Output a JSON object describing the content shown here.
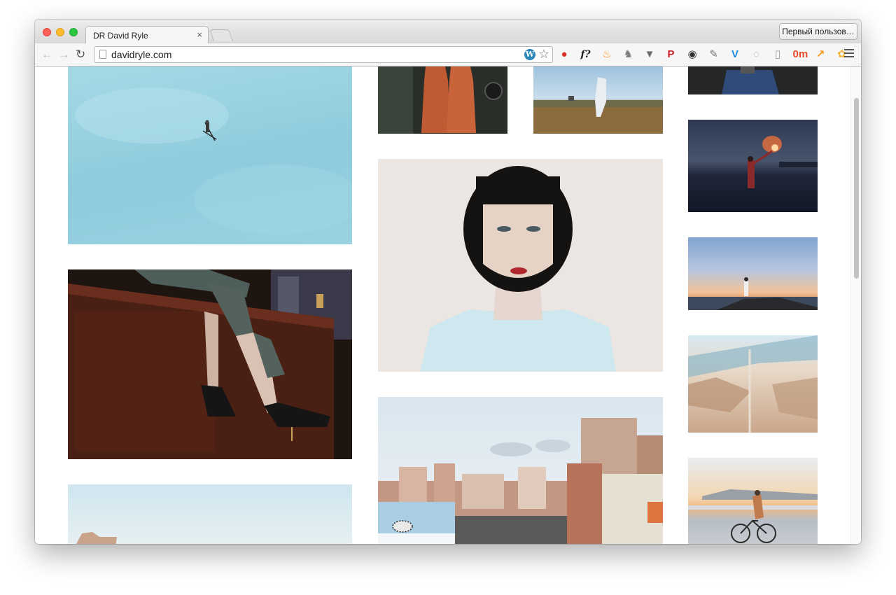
{
  "browser": {
    "tab_title": "DR David Ryle",
    "tab_close": "×",
    "profile_label": "Первый пользов…",
    "url": "davidryle.com",
    "back": "←",
    "forward": "→",
    "reload": "↻",
    "wp_letter": "W",
    "star": "☆",
    "extensions": [
      {
        "name": "adblock-icon",
        "color": "#d9302c",
        "glyph": "●"
      },
      {
        "name": "function-icon",
        "color": "#ffffff",
        "glyph": "f?"
      },
      {
        "name": "flame-icon",
        "color": "#ff8a00",
        "glyph": "♨"
      },
      {
        "name": "evernote-icon",
        "color": "#7c7c7c",
        "glyph": "♞"
      },
      {
        "name": "pocket-icon",
        "color": "#6d6d6d",
        "glyph": "▼"
      },
      {
        "name": "pinterest-icon",
        "color": "#cb2027",
        "glyph": "P"
      },
      {
        "name": "color-wheel-icon",
        "color": "#333333",
        "glyph": "◉"
      },
      {
        "name": "eyedropper-icon",
        "color": "#777777",
        "glyph": "✎"
      },
      {
        "name": "v-shield-icon",
        "color": "#1b8ce0",
        "glyph": "V"
      },
      {
        "name": "circle-arrow-icon",
        "color": "#9a9a9a",
        "glyph": "◌"
      },
      {
        "name": "reader-icon",
        "color": "#9a9a9a",
        "glyph": "▯"
      },
      {
        "name": "weather-icon",
        "color": "#e94a2c",
        "glyph": "0m"
      },
      {
        "name": "analytics-icon",
        "color": "#f39a1c",
        "glyph": "↗"
      },
      {
        "name": "paw-icon",
        "color": "#f2b53a",
        "glyph": "✿"
      }
    ]
  },
  "photos": [
    {
      "name": "photo-ski-jumper-sky",
      "subject": "ski jumper in blue sky"
    },
    {
      "name": "photo-dresses-mannequins",
      "subject": "two orange dresses"
    },
    {
      "name": "photo-figure-in-field",
      "subject": "figure in moorland"
    },
    {
      "name": "photo-blue-garment",
      "subject": "blue garment"
    },
    {
      "name": "photo-flare-water",
      "subject": "person with red flare in water"
    },
    {
      "name": "photo-portrait-woman",
      "subject": "woman with black bob"
    },
    {
      "name": "photo-legs-heels",
      "subject": "legs with heels on bar"
    },
    {
      "name": "photo-sunset-rock",
      "subject": "figure on rock at sunset"
    },
    {
      "name": "photo-aerial-desert",
      "subject": "aerial desert road"
    },
    {
      "name": "photo-city-zebra",
      "subject": "city street with zebra billboard"
    },
    {
      "name": "photo-beach-sky",
      "subject": "sky and rock"
    },
    {
      "name": "photo-bicycle-sea",
      "subject": "person with bicycle by sea"
    }
  ]
}
